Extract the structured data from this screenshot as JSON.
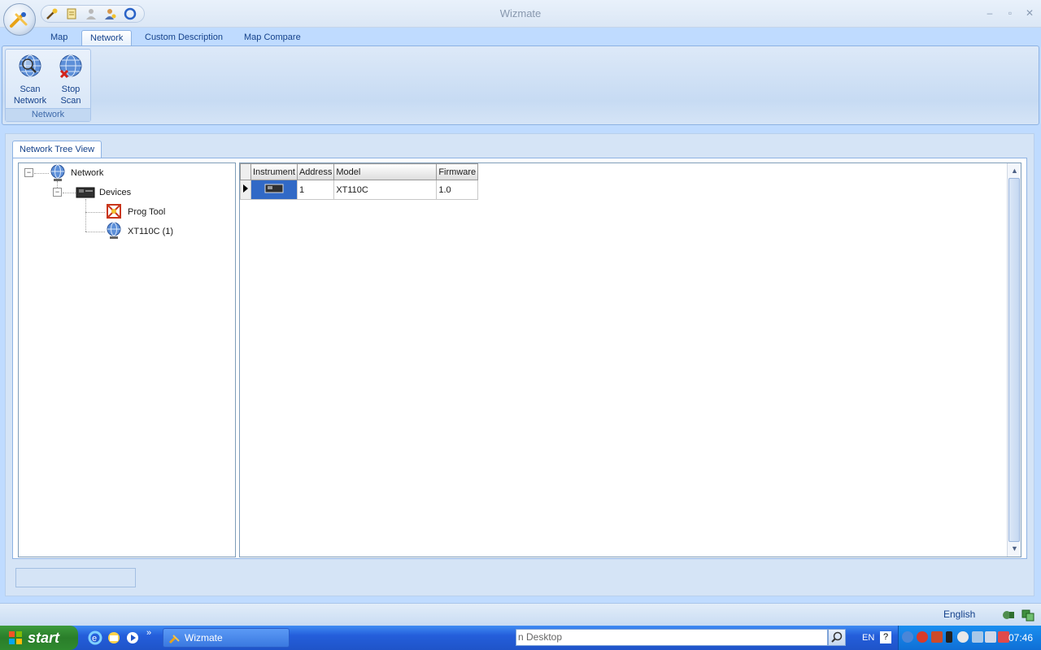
{
  "window": {
    "title": "Wizmate"
  },
  "ribbon": {
    "tabs": [
      {
        "label": "Map"
      },
      {
        "label": "Network"
      },
      {
        "label": "Custom Description"
      },
      {
        "label": "Map Compare"
      }
    ],
    "active_tab": "Network",
    "group": {
      "label": "Network",
      "buttons": [
        {
          "label_line1": "Scan",
          "label_line2": "Network",
          "icon": "globe-search-icon"
        },
        {
          "label_line1": "Stop",
          "label_line2": "Scan",
          "icon": "globe-stop-icon"
        }
      ]
    }
  },
  "document": {
    "tab_label": "Network Tree View"
  },
  "tree": {
    "root": {
      "label": "Network",
      "icon": "network-globe-icon"
    },
    "devices": {
      "label": "Devices",
      "icon": "device-icon"
    },
    "children": [
      {
        "label": "Prog Tool",
        "icon": "prog-tool-icon"
      },
      {
        "label": "XT110C (1)",
        "icon": "instrument-globe-icon"
      }
    ]
  },
  "grid": {
    "columns": [
      "Instrument",
      "Address",
      "Model",
      "Firmware"
    ],
    "rows": [
      {
        "instrument_icon": "device-icon",
        "address": "1",
        "model": "XT110C",
        "firmware": "1.0"
      }
    ]
  },
  "statusbar": {
    "language": "English"
  },
  "taskbar": {
    "start_label": "start",
    "task_label": "Wizmate",
    "search_text": "n Desktop",
    "lang_indicator": "EN",
    "clock": "07:46"
  },
  "colors": {
    "ribbon_text": "#15428b",
    "taskbar": "#245edb",
    "start": "#2a7e2a",
    "selection": "#3169c6"
  }
}
